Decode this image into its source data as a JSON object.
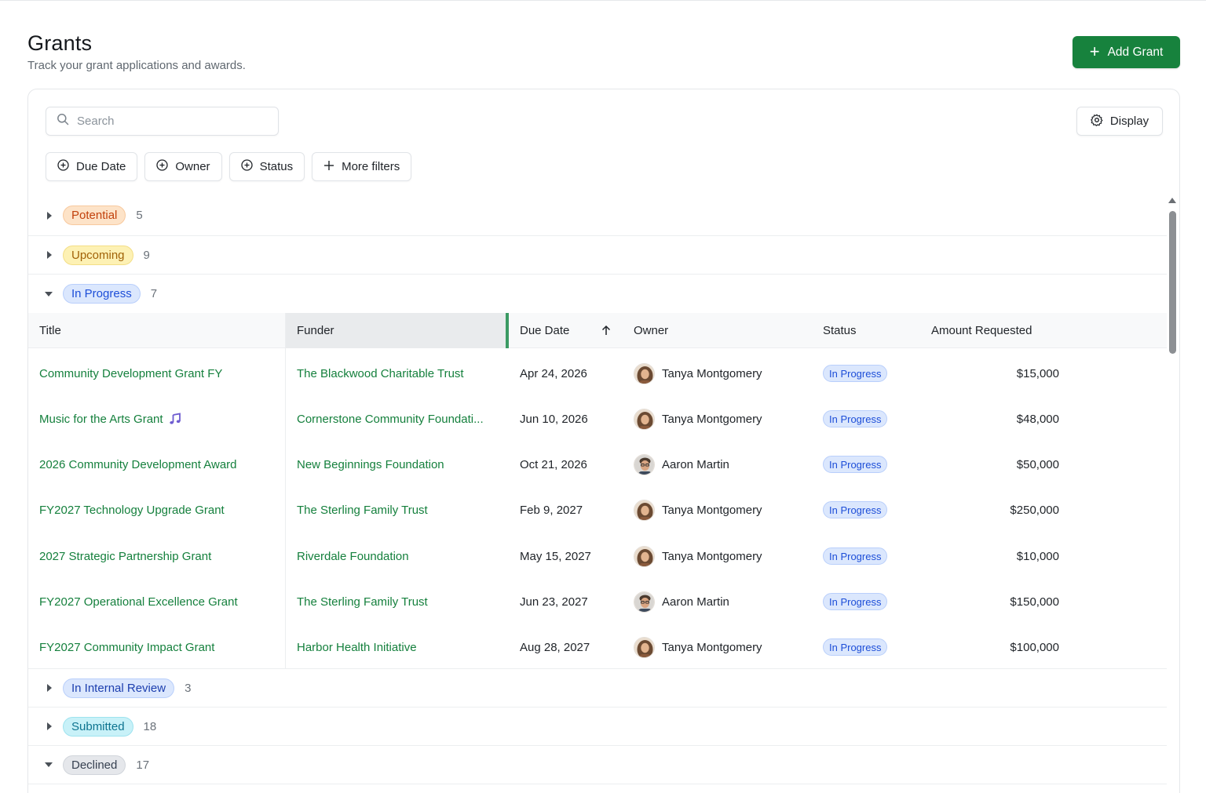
{
  "header": {
    "title": "Grants",
    "subtitle": "Track your grant applications and awards.",
    "add_label": "Add Grant"
  },
  "toolbar": {
    "search_placeholder": "Search",
    "display_label": "Display"
  },
  "filters": [
    {
      "label": "Due Date",
      "icon": "plus-circle-icon"
    },
    {
      "label": "Owner",
      "icon": "plus-circle-icon"
    },
    {
      "label": "Status",
      "icon": "plus-circle-icon"
    },
    {
      "label": "More filters",
      "icon": "plus-icon"
    }
  ],
  "groups": [
    {
      "label": "Potential",
      "count": "5",
      "expanded": false,
      "color": "#c2410c"
    },
    {
      "label": "Upcoming",
      "count": "9",
      "expanded": false,
      "color": "#a16207"
    },
    {
      "label": "In Progress",
      "count": "7",
      "expanded": true,
      "color": "#1d4ed8"
    },
    {
      "label": "In Internal Review",
      "count": "3",
      "expanded": false,
      "color": "#1e40af"
    },
    {
      "label": "Submitted",
      "count": "18",
      "expanded": false,
      "color": "#0e7490"
    },
    {
      "label": "Declined",
      "count": "17",
      "expanded": true,
      "color": "#374151"
    }
  ],
  "table": {
    "columns": [
      "Title",
      "Funder",
      "Due Date",
      "Owner",
      "Status",
      "Amount Requested"
    ],
    "sort": {
      "column": "Due Date",
      "direction": "ascending",
      "icon": "arrow-up-icon"
    },
    "rows": [
      {
        "title": "Community Development Grant FY",
        "funder": "The Blackwood Charitable Trust",
        "due": "Apr 24, 2026",
        "owner": "Tanya Montgomery",
        "status": "In Progress",
        "amount": "$15,000"
      },
      {
        "title": "Music for the Arts Grant",
        "title_icon": "music-note-icon",
        "funder": "Cornerstone Community Foundati...",
        "due": "Jun 10, 2026",
        "owner": "Tanya Montgomery",
        "status": "In Progress",
        "amount": "$48,000"
      },
      {
        "title": "2026 Community Development Award",
        "funder": "New Beginnings Foundation",
        "due": "Oct 21, 2026",
        "owner": "Aaron Martin",
        "status": "In Progress",
        "amount": "$50,000"
      },
      {
        "title": "FY2027 Technology Upgrade Grant",
        "funder": "The Sterling Family Trust",
        "due": "Feb 9, 2027",
        "owner": "Tanya Montgomery",
        "status": "In Progress",
        "amount": "$250,000"
      },
      {
        "title": "2027 Strategic Partnership Grant",
        "funder": "Riverdale Foundation",
        "due": "May 15, 2027",
        "owner": "Tanya Montgomery",
        "status": "In Progress",
        "amount": "$10,000"
      },
      {
        "title": "FY2027 Operational Excellence Grant",
        "funder": "The Sterling Family Trust",
        "due": "Jun 23, 2027",
        "owner": "Aaron Martin",
        "status": "In Progress",
        "amount": "$150,000"
      },
      {
        "title": "FY2027 Community Impact Grant",
        "funder": "Harbor Health Initiative",
        "due": "Aug 28, 2027",
        "owner": "Tanya Montgomery",
        "status": "In Progress",
        "amount": "$100,000"
      }
    ]
  },
  "colors": {
    "brand": "#17823d",
    "link": "#15803d",
    "accent_border": "#3b9a63"
  }
}
